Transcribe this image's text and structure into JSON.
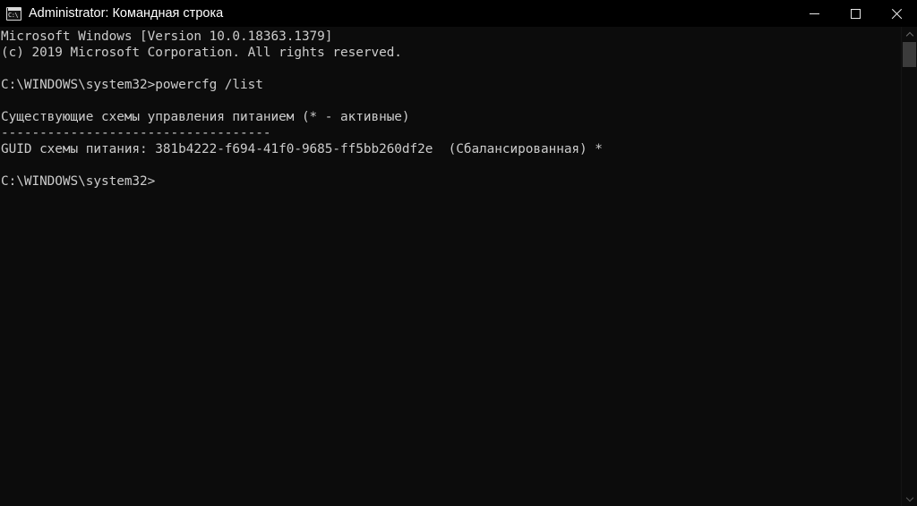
{
  "window": {
    "title": "Administrator: Командная строка",
    "icon": "cmd-console-icon",
    "icon_text": "C:\\",
    "background_color": "#0c0c0c",
    "titlebar_color": "#000000",
    "text_color": "#cccccc",
    "controls": {
      "minimize_label": "—",
      "maximize_label": "□",
      "close_label": "✕"
    }
  },
  "console": {
    "lines": [
      "Microsoft Windows [Version 10.0.18363.1379]",
      "(c) 2019 Microsoft Corporation. All rights reserved.",
      "",
      "C:\\WINDOWS\\system32>powercfg /list",
      "",
      "Существующие схемы управления питанием (* - активные)",
      "-----------------------------------",
      "GUID схемы питания: 381b4222-f694-41f0-9685-ff5bb260df2e  (Сбалансированная) *",
      "",
      "C:\\WINDOWS\\system32>"
    ],
    "text": "Microsoft Windows [Version 10.0.18363.1379]\n(c) 2019 Microsoft Corporation. All rights reserved.\n\nC:\\WINDOWS\\system32>powercfg /list\n\nСуществующие схемы управления питанием (* - активные)\n-----------------------------------\nGUID схемы питания: 381b4222-f694-41f0-9685-ff5bb260df2e  (Сбалансированная) *\n\nC:\\WINDOWS\\system32>",
    "command": "powercfg /list",
    "prompt": "C:\\WINDOWS\\system32>",
    "os_version": "10.0.18363.1379",
    "copyright_year": "2019",
    "power_scheme": {
      "guid": "381b4222-f694-41f0-9685-ff5bb260df2e",
      "name": "Сбалансированная",
      "active_marker": "*"
    }
  },
  "scrollbar": {
    "up_arrow": "scroll-up",
    "down_arrow": "scroll-down",
    "thumb_color": "#3b3b3b"
  }
}
